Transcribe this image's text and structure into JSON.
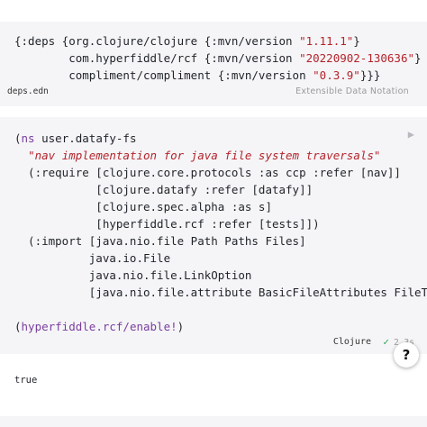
{
  "deps_block": {
    "lines": [
      {
        "a": "{:deps {org.clojure/clojure {:mvn/version ",
        "s": "\"1.11.1\"",
        "b": "}"
      },
      {
        "a": "        com.hyperfiddle/rcf {:mvn/version ",
        "s": "\"20220902-130636\"",
        "b": "}"
      },
      {
        "a": "        compliment/compliment {:mvn/version ",
        "s": "\"0.3.9\"",
        "b": "}}}"
      }
    ],
    "filename": "deps.edn",
    "language": "Extensible Data Notation"
  },
  "ns_block": {
    "l1_open": "(",
    "l1_kw": "ns",
    "l1_name": " user.datafy-fs",
    "l2_pre": "  ",
    "l2_doc": "\"nav implementation for java file system traversals\"",
    "l3": "  (:require [clojure.core.protocols :as ccp :refer [nav]]",
    "l4": "            [clojure.datafy :refer [datafy]]",
    "l5": "            [clojure.spec.alpha :as s]",
    "l6": "            [hyperfiddle.rcf :refer [tests]])",
    "l7": "  (:import [java.nio.file Path Paths Files]",
    "l8": "           java.io.File",
    "l9": "           java.nio.file.LinkOption",
    "l10": "           [java.nio.file.attribute BasicFileAttributes FileTim",
    "l12_open": "(",
    "l12_fn": "hyperfiddle.rcf/enable!",
    "l12_close": ")",
    "language": "Clojure",
    "status_icon": "check-icon",
    "time": "2.3s",
    "run_icon": "play-icon",
    "run_glyph": "▶",
    "check_glyph": "✓"
  },
  "result": {
    "value": "true"
  },
  "help_button": {
    "label": "?"
  }
}
